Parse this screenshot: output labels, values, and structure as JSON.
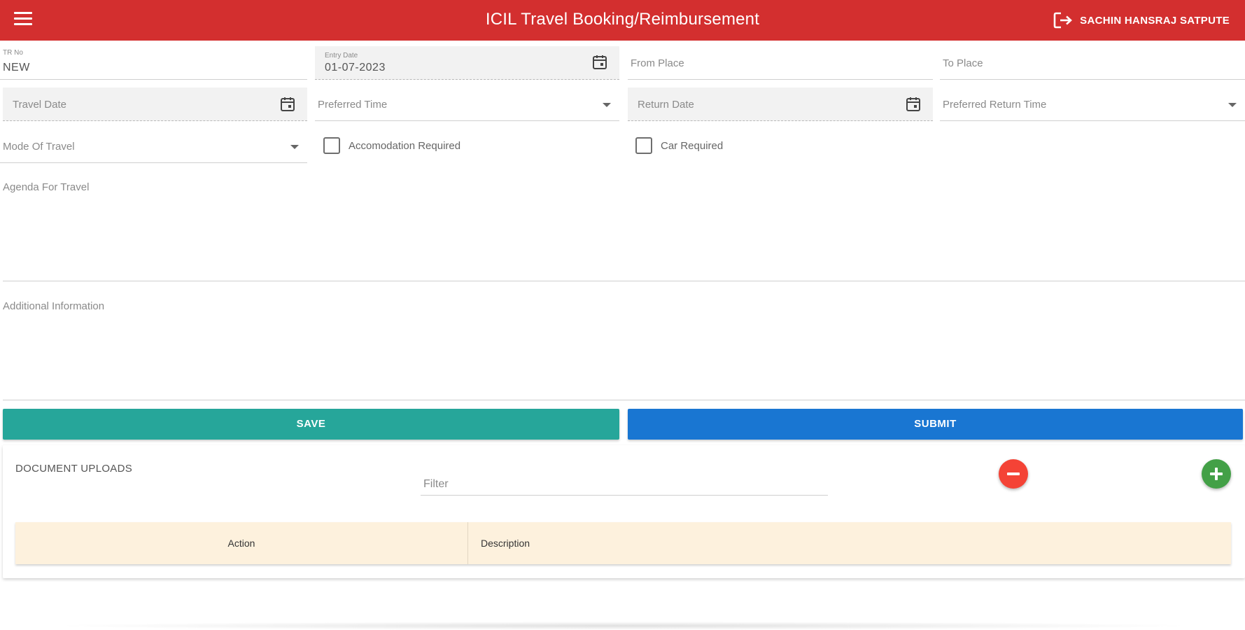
{
  "header": {
    "title": "ICIL Travel Booking/Reimbursement",
    "user_name": "SACHIN HANSRAJ SATPUTE",
    "bg_color": "#d32f2f"
  },
  "form": {
    "tr_no": {
      "label": "TR No",
      "value": "NEW"
    },
    "entry_date": {
      "label": "Entry Date",
      "value": "01-07-2023"
    },
    "from_place": {
      "label": "From Place"
    },
    "to_place": {
      "label": "To Place"
    },
    "travel_date": {
      "label": "Travel Date"
    },
    "preferred_time": {
      "label": "Preferred Time"
    },
    "return_date": {
      "label": "Return Date"
    },
    "preferred_return_time": {
      "label": "Preferred Return Time"
    },
    "mode_of_travel": {
      "label": "Mode Of Travel"
    },
    "accomodation_required": {
      "label": "Accomodation Required",
      "checked": false
    },
    "car_required": {
      "label": "Car Required",
      "checked": false
    },
    "agenda": {
      "label": "Agenda For Travel"
    },
    "additional_info": {
      "label": "Additional Information"
    }
  },
  "actions": {
    "save_label": "SAVE",
    "submit_label": "SUBMIT",
    "save_color": "#26a69a",
    "submit_color": "#1976d2"
  },
  "documents": {
    "title": "DOCUMENT UPLOADS",
    "filter_placeholder": "Filter",
    "columns": [
      "Action",
      "Description"
    ],
    "header_bg": "#fdf1dd",
    "remove_color": "#f44336",
    "add_color": "#43a047"
  }
}
